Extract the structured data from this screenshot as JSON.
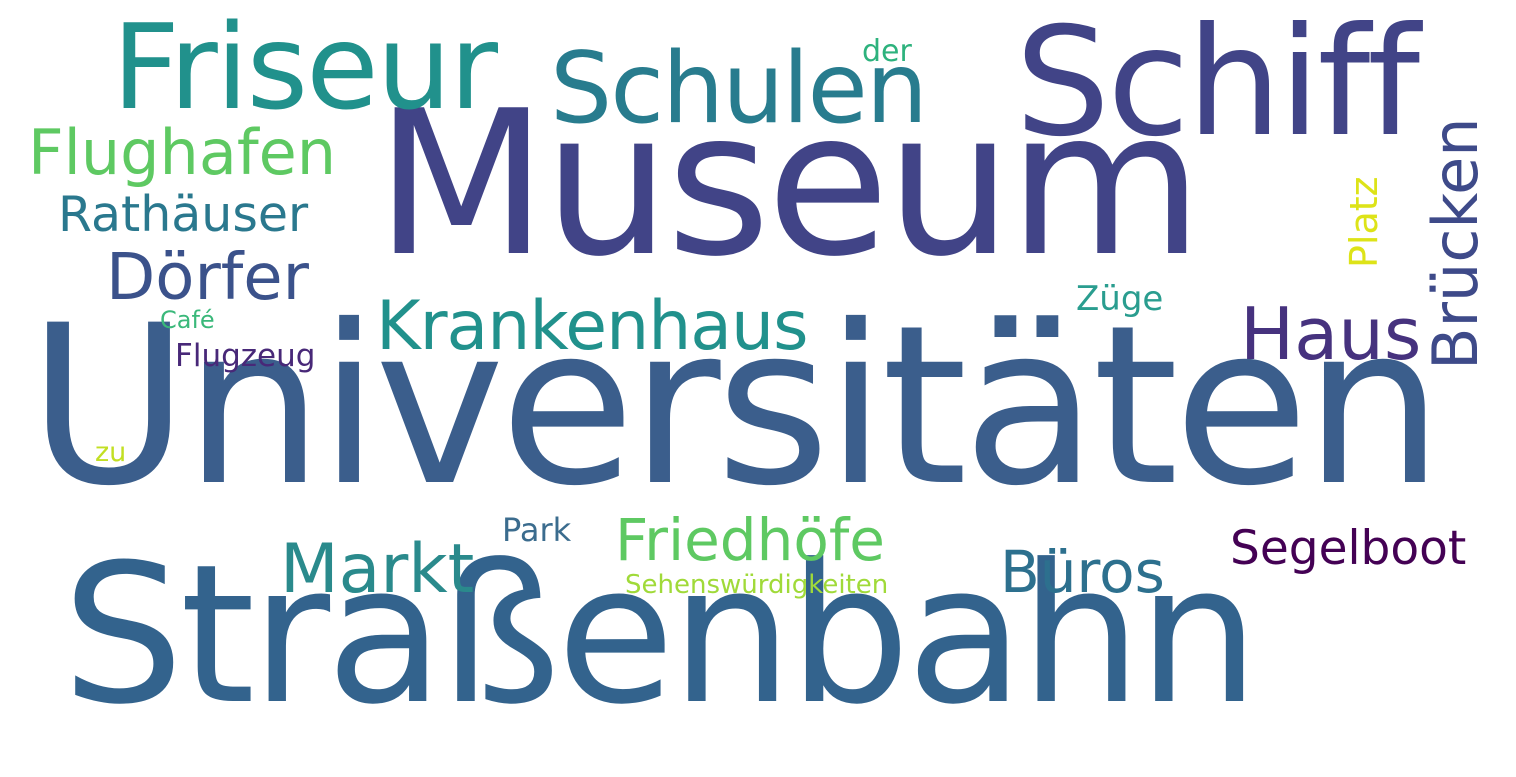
{
  "wordcloud": {
    "words": [
      {
        "key": "museum",
        "text": "Museum",
        "color": "#414487"
      },
      {
        "key": "universitaeten",
        "text": "Universitäten",
        "color": "#3b5e8c"
      },
      {
        "key": "strassenbahn",
        "text": "Straßenbahn",
        "color": "#33638d"
      },
      {
        "key": "schiff",
        "text": "Schiff",
        "color": "#414487"
      },
      {
        "key": "friseur",
        "text": "Friseur",
        "color": "#21918c"
      },
      {
        "key": "schulen",
        "text": "Schulen",
        "color": "#287c8e"
      },
      {
        "key": "flughafen",
        "text": "Flughafen",
        "color": "#5ec962"
      },
      {
        "key": "rathaeuser",
        "text": "Rathäuser",
        "color": "#2a788e"
      },
      {
        "key": "doerfer",
        "text": "Dörfer",
        "color": "#3b528b"
      },
      {
        "key": "krankenhaus",
        "text": "Krankenhaus",
        "color": "#21918c"
      },
      {
        "key": "haus",
        "text": "Haus",
        "color": "#46327e"
      },
      {
        "key": "bruecken",
        "text": "Brücken",
        "color": "#3e4a89"
      },
      {
        "key": "platz",
        "text": "Platz",
        "color": "#dde318"
      },
      {
        "key": "zuege",
        "text": "Züge",
        "color": "#2a9d8f"
      },
      {
        "key": "der",
        "text": "der",
        "color": "#2db27d"
      },
      {
        "key": "cafe",
        "text": "Café",
        "color": "#3ab87a"
      },
      {
        "key": "flugzeug",
        "text": "Flugzeug",
        "color": "#482878"
      },
      {
        "key": "zu",
        "text": "zu",
        "color": "#c2df23"
      },
      {
        "key": "park",
        "text": "Park",
        "color": "#3b6c8e"
      },
      {
        "key": "friedhoefe",
        "text": "Friedhöfe",
        "color": "#5ec962"
      },
      {
        "key": "markt",
        "text": "Markt",
        "color": "#2a8a8c"
      },
      {
        "key": "bueros",
        "text": "Büros",
        "color": "#2d708e"
      },
      {
        "key": "segelboot",
        "text": "Segelboot",
        "color": "#440154"
      },
      {
        "key": "sehens",
        "text": "Sehenswürdigkeiten",
        "color": "#a0da39"
      }
    ]
  }
}
